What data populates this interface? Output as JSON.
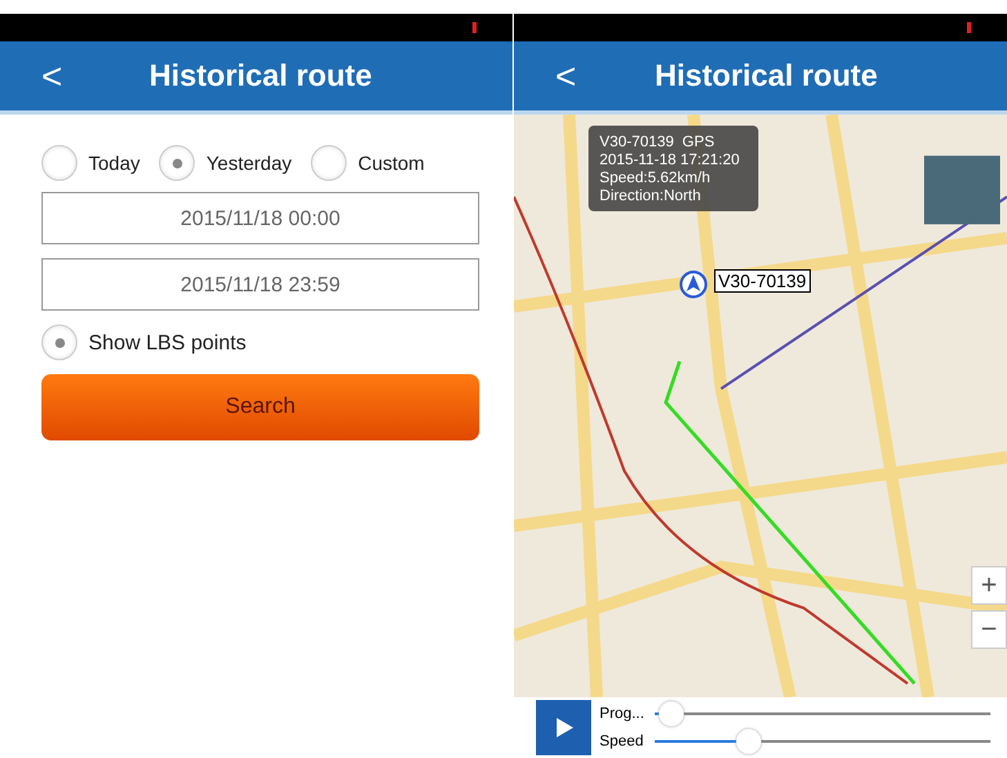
{
  "left_screen": {
    "header": {
      "back": "<",
      "title": "Historical route"
    },
    "range_options": [
      {
        "label": "Today",
        "selected": false
      },
      {
        "label": "Yesterday",
        "selected": true
      },
      {
        "label": "Custom",
        "selected": false
      }
    ],
    "start_time": {
      "value": "2015/11/18 00:00"
    },
    "end_time": {
      "value": "2015/11/18 23:59"
    },
    "show_lbs_points": {
      "label": "Show LBS points",
      "checked": true
    },
    "search_button": "Search"
  },
  "right_screen": {
    "header": {
      "back": "<",
      "title": "Historical route"
    },
    "popup": {
      "lines": [
        "V30-70139  GPS",
        "2015-11-18 17:21:20",
        "Speed:5.62km/h",
        "Direction:North"
      ]
    },
    "vehicle_label": "V30-70139",
    "zoom_buttons": [
      "+",
      "−"
    ],
    "progress": {
      "label": "Prog...",
      "level": 0.05
    },
    "speed": {
      "label": "Speed",
      "level": 0.28
    }
  }
}
